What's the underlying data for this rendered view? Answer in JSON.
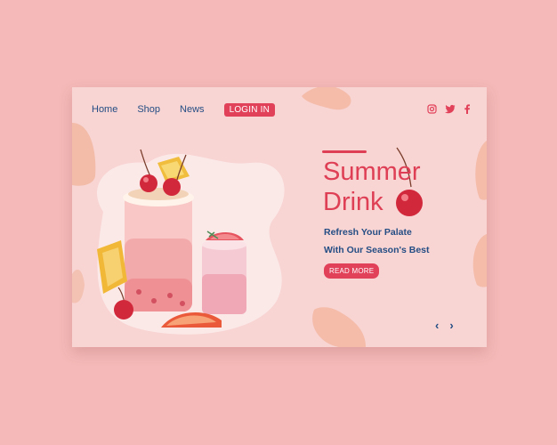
{
  "nav": {
    "home": "Home",
    "shop": "Shop",
    "news": "News",
    "login": "LOGIN IN"
  },
  "social": {
    "icons": [
      "instagram-icon",
      "twitter-icon",
      "facebook-icon"
    ]
  },
  "hero": {
    "title_line1": "Summer",
    "title_line2": "Drink",
    "subtitle_line1": "Refresh Your Palate",
    "subtitle_line2": "With Our Season's Best",
    "cta": "READ MORE"
  },
  "carousel": {
    "prev": "‹",
    "next": "›"
  },
  "colors": {
    "background": "#f4b9b8",
    "card": "#f8d4d3",
    "accent": "#e2415a",
    "text": "#244e84"
  }
}
